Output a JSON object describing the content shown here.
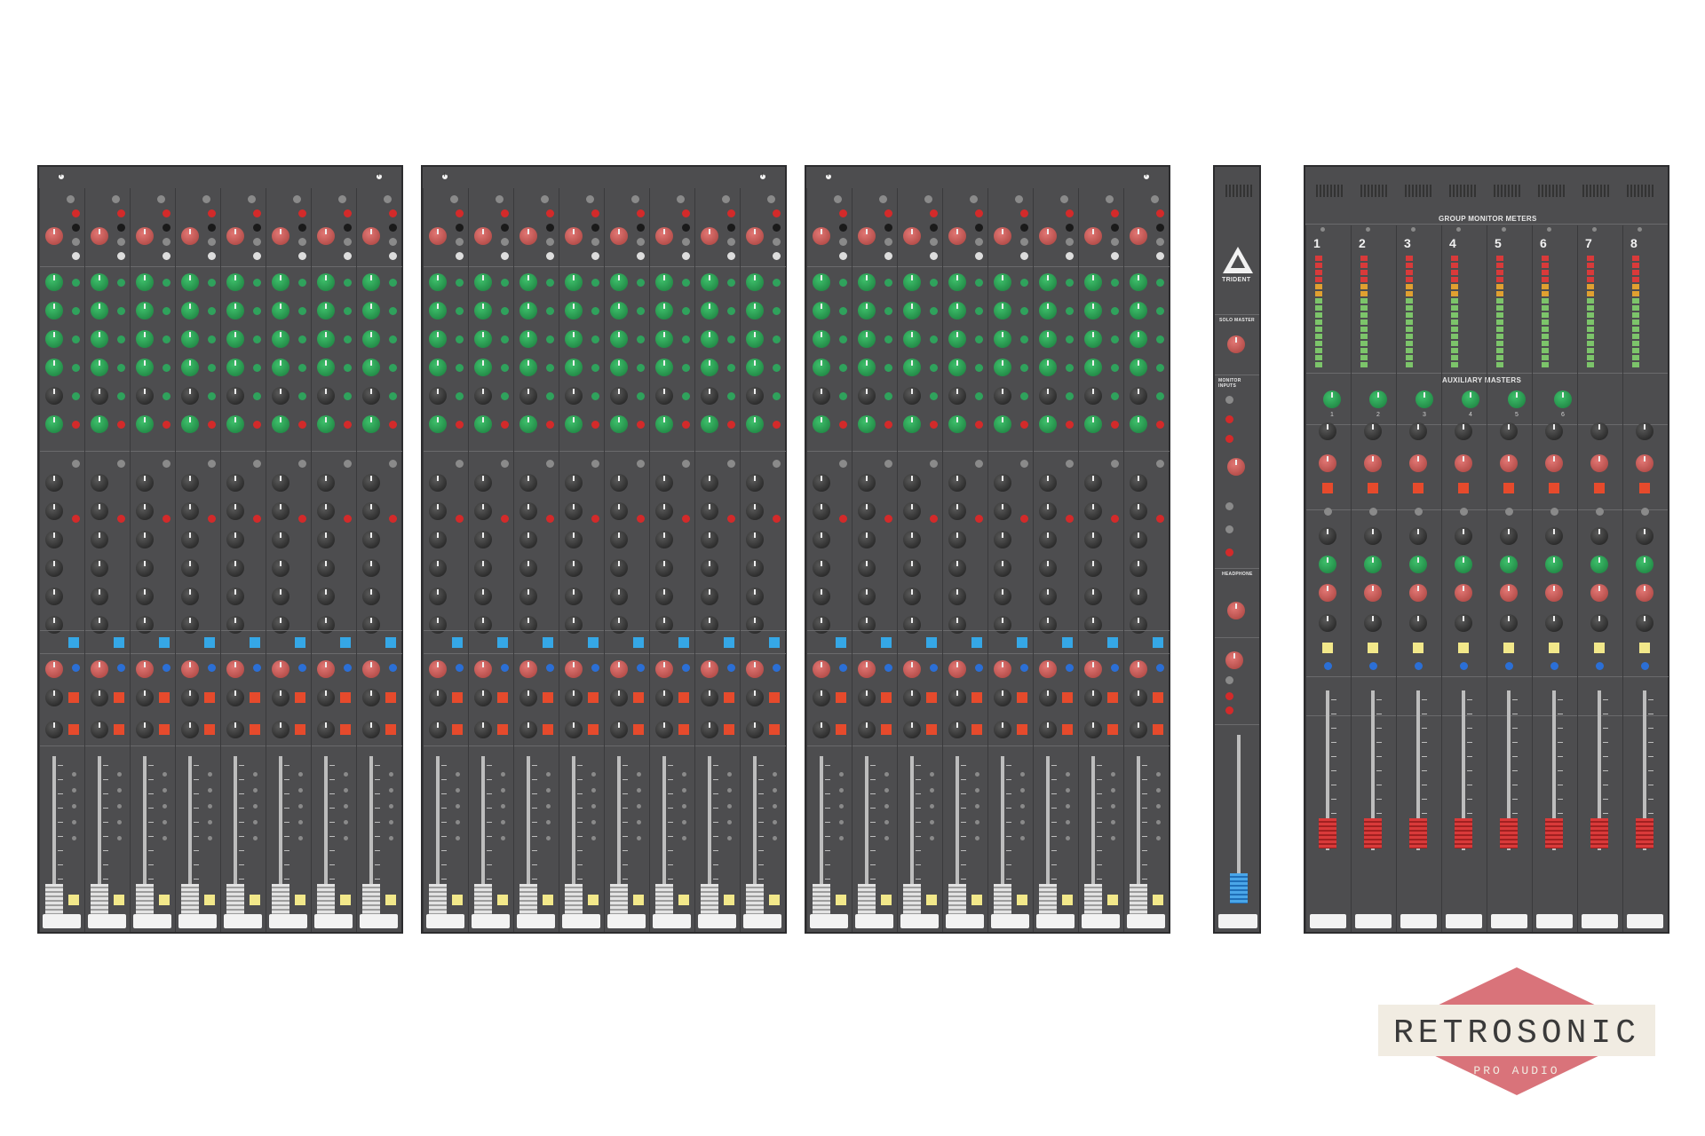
{
  "master": {
    "section_meters": "GROUP MONITOR METERS",
    "section_aux": "AUXILIARY MASTERS",
    "meter_numbers": [
      "1",
      "2",
      "3",
      "4",
      "5",
      "6",
      "7",
      "8"
    ],
    "aux_numbers": [
      "1",
      "2",
      "3",
      "4",
      "5",
      "6"
    ]
  },
  "center": {
    "brand": "TRIDENT",
    "solo_master": "SOLO MASTER",
    "monitor_inputs": "MONITOR INPUTS",
    "headphone": "HEADPHONE"
  },
  "logo": {
    "name": "RETROSONIC",
    "sub": "PRO AUDIO",
    "colors": {
      "diamond": "#d9737a",
      "band": "#f1ece2",
      "text": "#3a3a3a"
    }
  },
  "colors": {
    "panel": "#4d4d4f",
    "knob_green": "#2a9b52",
    "knob_red": "#c85a55",
    "fader_red": "#d93a3a"
  }
}
